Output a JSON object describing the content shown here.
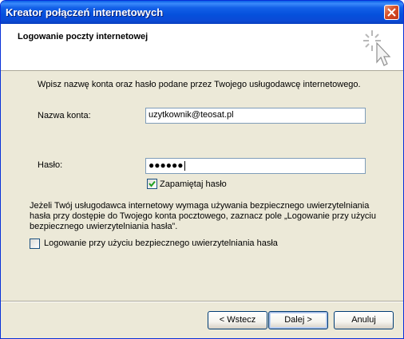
{
  "window": {
    "title": "Kreator połączeń internetowych"
  },
  "header": {
    "title": "Logowanie poczty internetowej"
  },
  "instructions": "Wpisz nazwę konta oraz hasło podane przez Twojego usługodawcę internetowego.",
  "account": {
    "label": "Nazwa konta:",
    "value": "uzytkownik@teosat.pl"
  },
  "password": {
    "label": "Hasło:",
    "masked": "●●●●●●"
  },
  "remember": {
    "label": "Zapamiętaj hasło",
    "checked": true
  },
  "spa": {
    "info": "Jeżeli Twój usługodawca internetowy wymaga używania bezpiecznego uwierzytelniania hasła przy dostępie do Twojego konta pocztowego, zaznacz pole „Logowanie przy użyciu bezpiecznego uwierzytelniania hasła”.",
    "label": "Logowanie przy użyciu bezpiecznego uwierzytelniania hasła",
    "checked": false
  },
  "buttons": {
    "back": "< Wstecz",
    "next": "Dalej >",
    "cancel": "Anuluj"
  },
  "icons": {
    "close": "close-icon",
    "wizard": "wizard-cursor-icon",
    "check": "check-icon"
  }
}
